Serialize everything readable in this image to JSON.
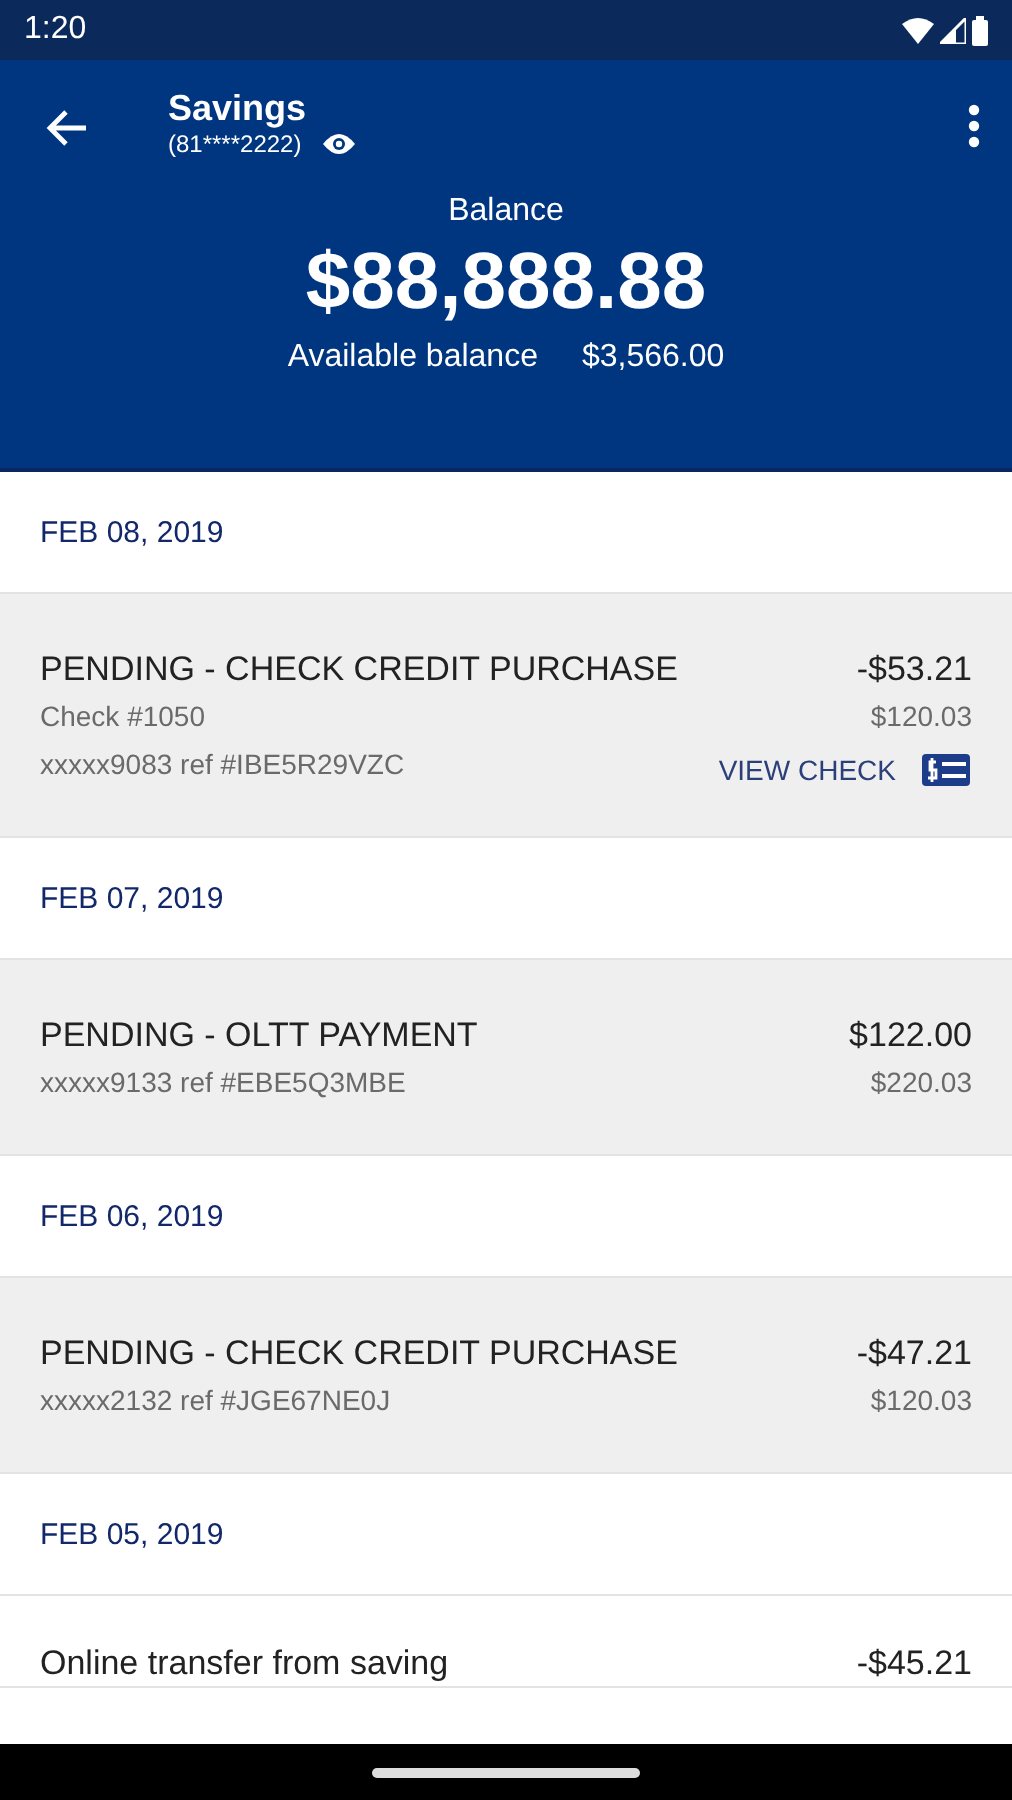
{
  "status_bar": {
    "time": "1:20"
  },
  "header": {
    "title": "Savings",
    "account_number": "(81****2222)",
    "balance_label": "Balance",
    "balance": "$88,888.88",
    "available_label": "Available balance",
    "available": "$3,566.00"
  },
  "groups": [
    {
      "date": "FEB 08, 2019",
      "transactions": [
        {
          "title": "PENDING - CHECK CREDIT PURCHASE",
          "check_number": "Check #1050",
          "ref": "xxxxx9083 ref #IBE5R29VZC",
          "amount": "-$53.21",
          "balance": "$120.03",
          "view_check": "VIEW CHECK"
        }
      ]
    },
    {
      "date": "FEB 07, 2019",
      "transactions": [
        {
          "title": "PENDING - OLTT PAYMENT",
          "ref": "xxxxx9133 ref #EBE5Q3MBE",
          "amount": "$122.00",
          "balance": "$220.03"
        }
      ]
    },
    {
      "date": "FEB 06, 2019",
      "transactions": [
        {
          "title": "PENDING - CHECK CREDIT PURCHASE",
          "ref": "xxxxx2132 ref #JGE67NE0J",
          "amount": "-$47.21",
          "balance": "$120.03"
        }
      ]
    },
    {
      "date": "FEB 05, 2019",
      "transactions": [
        {
          "title": "Online transfer from saving",
          "amount": "-$45.21"
        }
      ]
    }
  ]
}
